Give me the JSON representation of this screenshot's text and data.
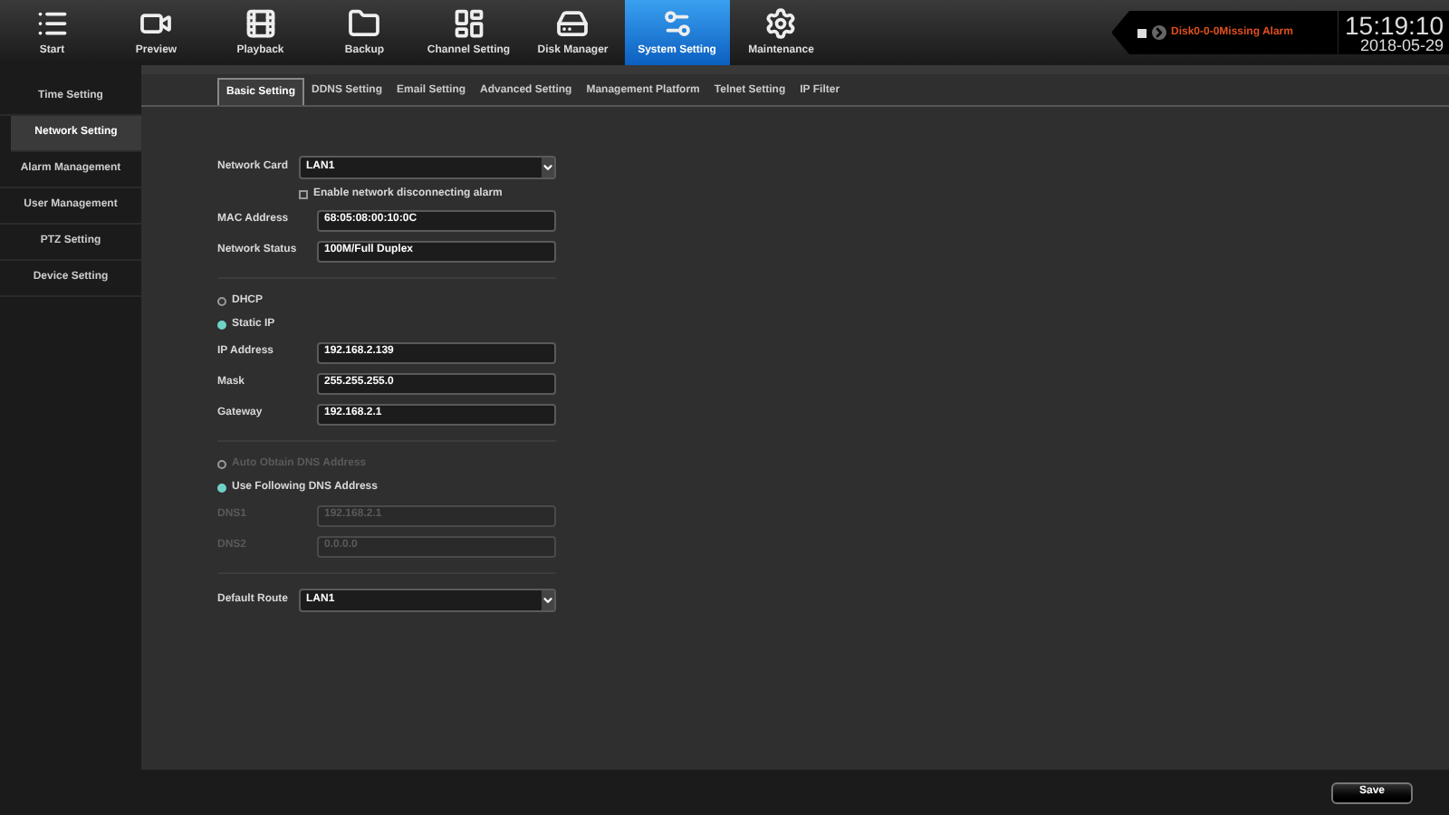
{
  "top_nav": [
    {
      "label": "Start",
      "selected": false
    },
    {
      "label": "Preview",
      "selected": false
    },
    {
      "label": "Playback",
      "selected": false
    },
    {
      "label": "Backup",
      "selected": false
    },
    {
      "label": "Channel Setting",
      "selected": false
    },
    {
      "label": "Disk Manager",
      "selected": false
    },
    {
      "label": "System Setting",
      "selected": true
    },
    {
      "label": "Maintenance",
      "selected": false
    }
  ],
  "alarm": {
    "text": "Disk0-0-0Missing Alarm",
    "time": "15:19:10",
    "date": "2018-05-29"
  },
  "sidebar": [
    {
      "label": "Time Setting",
      "selected": false
    },
    {
      "label": "Network Setting",
      "selected": true
    },
    {
      "label": "Alarm Management",
      "selected": false
    },
    {
      "label": "User Management",
      "selected": false
    },
    {
      "label": "PTZ Setting",
      "selected": false
    },
    {
      "label": "Device Setting",
      "selected": false
    }
  ],
  "tabs": [
    {
      "label": "Basic Setting",
      "selected": true
    },
    {
      "label": "DDNS Setting",
      "selected": false
    },
    {
      "label": "Email Setting",
      "selected": false
    },
    {
      "label": "Advanced Setting",
      "selected": false
    },
    {
      "label": "Management Platform",
      "selected": false
    },
    {
      "label": "Telnet Setting",
      "selected": false
    },
    {
      "label": "IP Filter",
      "selected": false
    }
  ],
  "form_groups": [
    [
      {
        "kind": "select",
        "label": "Network Card",
        "value": "LAN1"
      },
      {
        "kind": "checkbox",
        "label": "Enable network disconnecting alarm",
        "checked": false
      },
      {
        "kind": "text",
        "label": "MAC Address",
        "value": "68:05:08:00:10:0C",
        "disabled": false
      },
      {
        "kind": "text",
        "label": "Network Status",
        "value": "100M/Full Duplex",
        "disabled": false
      }
    ],
    [
      {
        "kind": "radio",
        "label": "DHCP",
        "selected": false,
        "disabled": false
      },
      {
        "kind": "radio",
        "label": "Static IP",
        "selected": true,
        "disabled": false
      },
      {
        "kind": "text",
        "label": "IP Address",
        "value": "192.168.2.139",
        "disabled": false
      },
      {
        "kind": "text",
        "label": "Mask",
        "value": "255.255.255.0",
        "disabled": false
      },
      {
        "kind": "text",
        "label": "Gateway",
        "value": "192.168.2.1",
        "disabled": false
      }
    ],
    [
      {
        "kind": "radio",
        "label": "Auto Obtain DNS Address",
        "selected": false,
        "disabled": true
      },
      {
        "kind": "radio",
        "label": "Use Following DNS Address",
        "selected": true,
        "disabled": false
      },
      {
        "kind": "text",
        "label": "DNS1",
        "value": "192.168.2.1",
        "disabled": true
      },
      {
        "kind": "text",
        "label": "DNS2",
        "value": "0.0.0.0",
        "disabled": true
      }
    ],
    [
      {
        "kind": "select",
        "label": "Default Route",
        "value": "LAN1"
      }
    ]
  ],
  "save_button": "Save"
}
